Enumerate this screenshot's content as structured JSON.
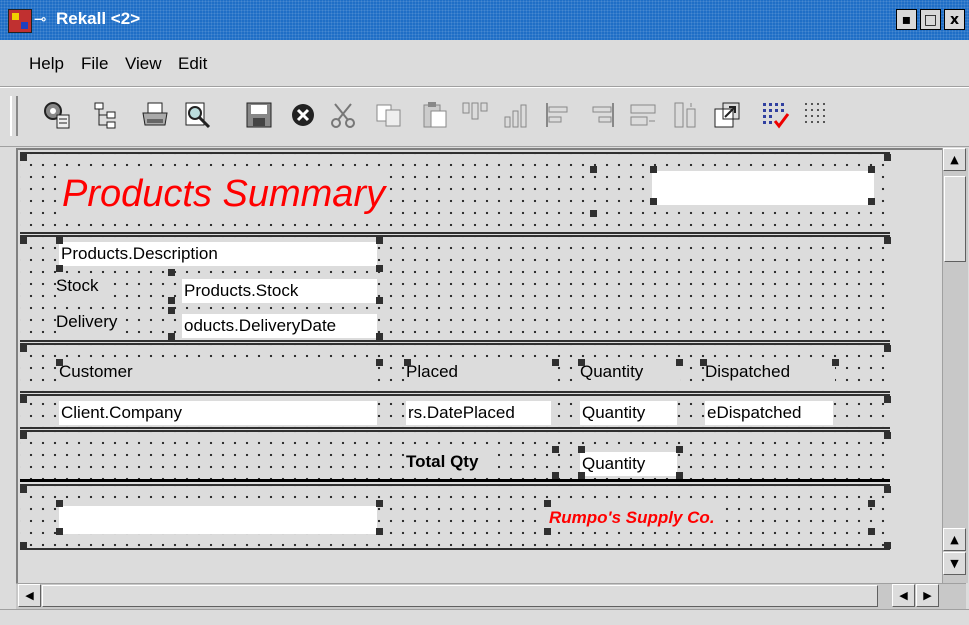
{
  "window": {
    "title": "Rekall <2>",
    "buttons": {
      "minimize": "▪",
      "maximize": "□",
      "close": "x"
    }
  },
  "menu": {
    "items": [
      "Help",
      "File",
      "View",
      "Edit"
    ]
  },
  "toolbar": {
    "icons": [
      "properties-icon",
      "tree-icon",
      "print-icon",
      "print-preview-icon",
      "save-icon",
      "cancel-icon",
      "cut-icon",
      "copy-icon",
      "paste-icon",
      "align-icon",
      "chart-icon",
      "align-left-icon",
      "align-right-icon",
      "size-icon",
      "vertical-size-icon",
      "resize-icon",
      "grid-on-icon",
      "grid-icon"
    ]
  },
  "report": {
    "header": {
      "title": "Products Summary"
    },
    "products": {
      "description_field": "Products.Description",
      "stock_label": "Stock",
      "stock_field": "Products.Stock",
      "delivery_label": "Delivery",
      "delivery_field": "oducts.DeliveryDate"
    },
    "orders_header": {
      "customer": "Customer",
      "placed": "Placed",
      "quantity": "Quantity",
      "dispatched": "Dispatched"
    },
    "orders_row": {
      "company": "Client.Company",
      "placed": "rs.DatePlaced",
      "quantity": "Quantity",
      "dispatched": "eDispatched"
    },
    "total": {
      "label": "Total Qty",
      "quantity": "Quantity"
    },
    "footer": {
      "company": "Rumpo's Supply Co."
    }
  },
  "colors": {
    "title_bar": "#1f6ec6",
    "report_title": "#ff0000",
    "background": "#dcdcdc"
  }
}
